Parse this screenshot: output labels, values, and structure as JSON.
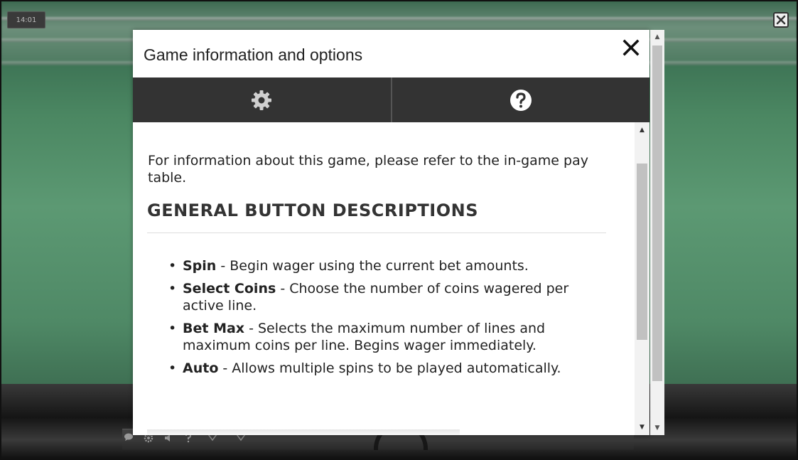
{
  "game": {
    "clock": "14:01",
    "bottom_icons": [
      "chat-icon",
      "settings-icon",
      "volume-icon",
      "help-icon"
    ]
  },
  "dialog": {
    "title": "Game information and options",
    "tabs": [
      {
        "icon": "gear-icon",
        "active": false
      },
      {
        "icon": "question-icon",
        "active": true
      }
    ]
  },
  "content": {
    "intro": "For information about this game, please refer to the in-game pay table.",
    "heading": "GENERAL BUTTON DESCRIPTIONS",
    "items": [
      {
        "term": "Spin",
        "desc": " - Begin wager using the current bet amounts."
      },
      {
        "term": "Select Coins",
        "desc": " - Choose the number of coins wagered per active line."
      },
      {
        "term": "Bet Max",
        "desc": " - Selects the maximum number of lines and maximum coins per line. Begins wager immediately."
      },
      {
        "term": "Auto",
        "desc": " - Allows multiple spins to be played automatically."
      }
    ]
  },
  "colors": {
    "tab_bar": "#333333",
    "dialog_bg": "#ffffff",
    "text": "#222222"
  }
}
